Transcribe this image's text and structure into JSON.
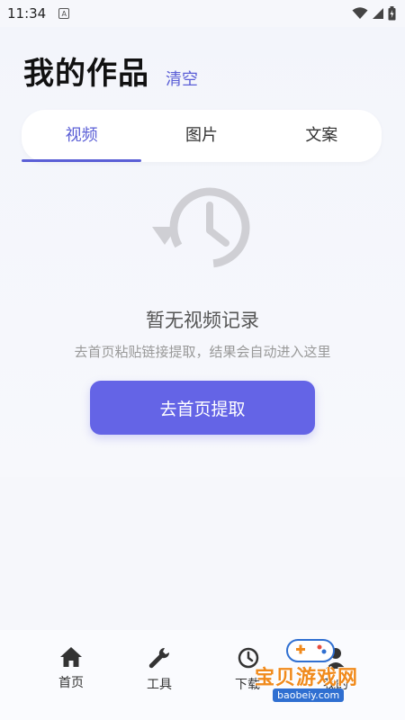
{
  "status_bar": {
    "time": "11:34",
    "notification_icon": "A"
  },
  "header": {
    "title": "我的作品",
    "clear_label": "清空"
  },
  "tabs": [
    {
      "label": "视频",
      "active": true
    },
    {
      "label": "图片",
      "active": false
    },
    {
      "label": "文案",
      "active": false
    }
  ],
  "empty_state": {
    "icon": "history-icon",
    "title": "暂无视频记录",
    "subtitle": "去首页粘贴链接提取，结果会自动进入这里",
    "button_label": "去首页提取"
  },
  "bottom_nav": [
    {
      "label": "首页",
      "icon": "home-icon"
    },
    {
      "label": "工具",
      "icon": "wrench-icon"
    },
    {
      "label": "下载",
      "icon": "history-icon"
    },
    {
      "label": "我的",
      "icon": "user-icon"
    }
  ],
  "watermark": {
    "text": "宝贝游戏网",
    "url": "baobeiy.com"
  },
  "colors": {
    "accent": "#5b5fd6",
    "button": "#6464e6",
    "watermark": "#f08a1c"
  }
}
